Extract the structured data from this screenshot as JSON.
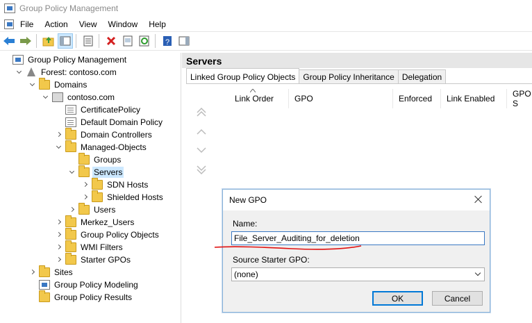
{
  "window": {
    "title": "Group Policy Management"
  },
  "menu": [
    "File",
    "Action",
    "View",
    "Window",
    "Help"
  ],
  "tree": [
    {
      "label": "Group Policy Management",
      "icon": "gpm-icon",
      "indent": 0,
      "chev": "none"
    },
    {
      "label": "Forest: contoso.com",
      "icon": "forest-icon",
      "indent": 1,
      "chev": "down"
    },
    {
      "label": "Domains",
      "icon": "folder-icon",
      "indent": 2,
      "chev": "down"
    },
    {
      "label": "contoso.com",
      "icon": "domain-icon",
      "indent": 3,
      "chev": "down"
    },
    {
      "label": "CertificatePolicy",
      "icon": "gpo-link-icon",
      "indent": 4,
      "chev": "none"
    },
    {
      "label": "Default Domain Policy",
      "icon": "gpo-link-icon",
      "indent": 4,
      "chev": "none"
    },
    {
      "label": "Domain Controllers",
      "icon": "folder-icon",
      "indent": 4,
      "chev": "right"
    },
    {
      "label": "Managed-Objects",
      "icon": "folder-icon",
      "indent": 4,
      "chev": "down"
    },
    {
      "label": "Groups",
      "icon": "folder-icon",
      "indent": 5,
      "chev": "none"
    },
    {
      "label": "Servers",
      "icon": "folder-icon",
      "indent": 5,
      "chev": "down",
      "selected": true
    },
    {
      "label": "SDN Hosts",
      "icon": "folder-icon",
      "indent": 6,
      "chev": "right"
    },
    {
      "label": "Shielded Hosts",
      "icon": "folder-icon",
      "indent": 6,
      "chev": "right"
    },
    {
      "label": "Users",
      "icon": "folder-icon",
      "indent": 5,
      "chev": "right"
    },
    {
      "label": "Merkez_Users",
      "icon": "folder-icon",
      "indent": 4,
      "chev": "right"
    },
    {
      "label": "Group Policy Objects",
      "icon": "folder-icon",
      "indent": 4,
      "chev": "right"
    },
    {
      "label": "WMI Filters",
      "icon": "folder-icon",
      "indent": 4,
      "chev": "right"
    },
    {
      "label": "Starter GPOs",
      "icon": "folder-icon",
      "indent": 4,
      "chev": "right"
    },
    {
      "label": "Sites",
      "icon": "folder-icon",
      "indent": 2,
      "chev": "right"
    },
    {
      "label": "Group Policy Modeling",
      "icon": "gpm-icon",
      "indent": 2,
      "chev": "none"
    },
    {
      "label": "Group Policy Results",
      "icon": "folder-icon",
      "indent": 2,
      "chev": "none"
    }
  ],
  "right": {
    "header": "Servers",
    "tabs": [
      "Linked Group Policy Objects",
      "Group Policy Inheritance",
      "Delegation"
    ],
    "columns": [
      "Link Order",
      "GPO",
      "Enforced",
      "Link Enabled",
      "GPO S"
    ]
  },
  "dialog": {
    "title": "New GPO",
    "name_label": "Name:",
    "name_value": "File_Server_Auditing_for_deletion",
    "source_label": "Source Starter GPO:",
    "source_value": "(none)",
    "ok": "OK",
    "cancel": "Cancel"
  },
  "colors": {
    "accent": "#0078d7",
    "selection": "#cce8ff",
    "annotation": "#e01010"
  }
}
